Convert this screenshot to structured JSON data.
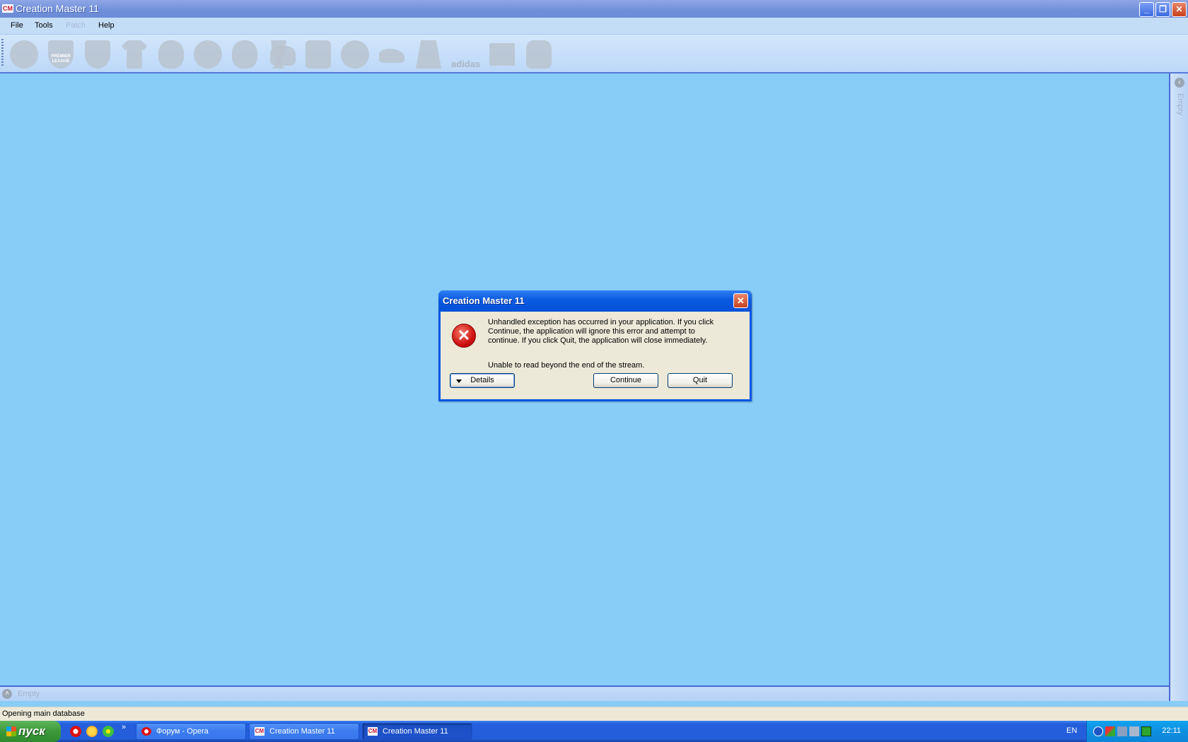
{
  "window": {
    "title": "Creation Master 11",
    "icon_text": "CM"
  },
  "menu": {
    "items": [
      {
        "label": "File",
        "enabled": true
      },
      {
        "label": "Tools",
        "enabled": true
      },
      {
        "label": "Patch",
        "enabled": false
      },
      {
        "label": "Help",
        "enabled": true
      }
    ]
  },
  "toolbar": {
    "icons": [
      {
        "name": "world-globe-icon"
      },
      {
        "name": "premier-league-icon",
        "text": "PREMIER LEAGUE"
      },
      {
        "name": "club-crest-icon"
      },
      {
        "name": "kit-shirt-icon"
      },
      {
        "name": "player-head-icon"
      },
      {
        "name": "stadium-icon"
      },
      {
        "name": "manager-head-icon"
      },
      {
        "name": "trophy-icon"
      },
      {
        "name": "gamepad-icon"
      },
      {
        "name": "handshake-transfer-icon"
      },
      {
        "name": "football-ball-icon"
      },
      {
        "name": "boots-icon"
      },
      {
        "name": "pitch-field-icon"
      },
      {
        "name": "nike-adidas-brand-icon",
        "text": "adidas"
      },
      {
        "name": "newspaper-icon"
      },
      {
        "name": "goalkeeper-glove-icon"
      }
    ]
  },
  "right_panel": {
    "label": "Empty"
  },
  "bottom_panel": {
    "label": "Empty"
  },
  "status_bar": {
    "text": "Opening main database"
  },
  "dialog": {
    "title": "Creation Master 11",
    "message": "Unhandled exception has occurred in your application. If you click Continue, the application will ignore this error and attempt to continue. If you click Quit, the application will close immediately.",
    "detail": "Unable to read beyond the end of the stream.",
    "details_button": "Details",
    "continue_button": "Continue",
    "quit_button": "Quit",
    "icon": "error-icon"
  },
  "taskbar": {
    "start_label": "пуск",
    "quick_launch": [
      "opera-icon",
      "mail-agent-icon",
      "icq-icon"
    ],
    "quick_launch_more": "»",
    "tasks": [
      {
        "label": "Форум - Opera",
        "icon": "opera-icon",
        "active": false
      },
      {
        "label": "Creation Master 11",
        "icon": "cm-icon",
        "active": false
      },
      {
        "label": "Creation Master 11",
        "icon": "cm-icon",
        "active": true
      }
    ],
    "language": "EN",
    "clock": "22:11"
  },
  "colors": {
    "workspace_bg": "#87cdf7",
    "xp_blue": "#245edb",
    "dialog_body": "#ece9d8",
    "error_red": "#d01212"
  }
}
